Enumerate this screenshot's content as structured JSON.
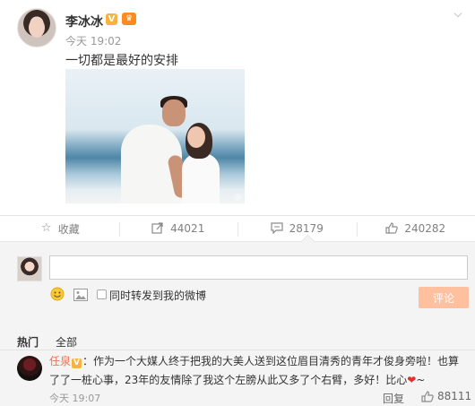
{
  "post": {
    "author": "李冰冰",
    "verified_badge": "V",
    "time": "今天 19:02",
    "text": "一切都是最好的安排",
    "menu_icon": "chevron-down-icon"
  },
  "actions": [
    {
      "icon": "star-icon",
      "label": "收藏"
    },
    {
      "icon": "share-icon",
      "label": "44021"
    },
    {
      "icon": "comment-icon",
      "label": "28179"
    },
    {
      "icon": "thumbs-up-icon",
      "label": "240282"
    }
  ],
  "composer": {
    "input_value": "",
    "repost_label": "同时转发到我的微博",
    "submit_label": "评论"
  },
  "comments_tabs": {
    "hot": "热门",
    "all": "全部"
  },
  "top_comment": {
    "user": "任泉",
    "verified_badge": "V",
    "line1": "：作为一个大媒人终于把我的大美人送到这位眉目清秀的青年才俊身旁啦！也算",
    "line2": "了了一桩心事，23年的友情除了我这个左膀从此又多了个右臂，多好！比心",
    "line2_suffix": "~",
    "time": "今天 19:07",
    "reply_label": "回复",
    "likes": "88111"
  },
  "colors": {
    "accent_orange": "#eb7350",
    "submit_disabled": "#ffc09f",
    "badge_gold": "#f7b33d"
  }
}
